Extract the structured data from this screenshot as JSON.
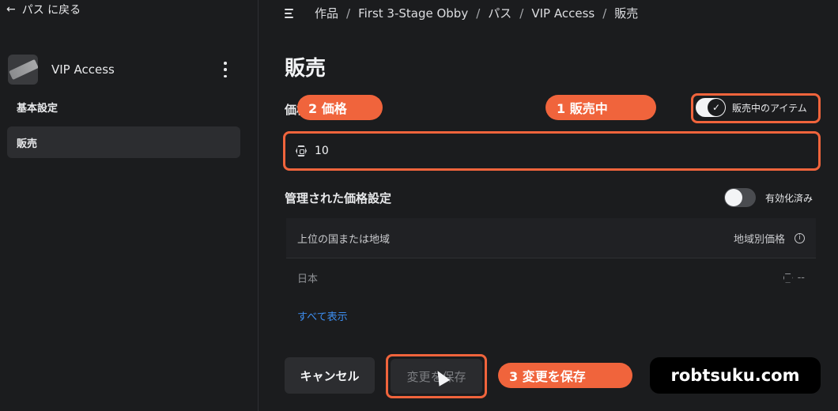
{
  "sidebar": {
    "back_label": "パス に戻る",
    "pass_name": "VIP Access",
    "items": [
      {
        "label": "基本設定"
      },
      {
        "label": "販売"
      }
    ]
  },
  "breadcrumb": [
    "作品",
    "First 3-Stage Obby",
    "パス",
    "VIP Access",
    "販売"
  ],
  "page_title": "販売",
  "price": {
    "label": "価格",
    "value": "10"
  },
  "sale_toggle": {
    "label": "販売中のアイテム",
    "state": "on"
  },
  "managed_pricing": {
    "title": "管理された価格設定",
    "status": "有効化済み",
    "state": "off"
  },
  "region_table": {
    "header_left": "上位の国または地域",
    "header_right": "地域別価格",
    "rows": [
      {
        "region": "日本",
        "price": "--"
      }
    ],
    "show_all": "すべて表示"
  },
  "buttons": {
    "cancel": "キャンセル",
    "save": "変更を保存"
  },
  "annotations": {
    "a1": "1 販売中",
    "a2": "2 価格",
    "a3": "3 変更を保存"
  },
  "watermark": "robtsuku.com",
  "colors": {
    "annotation": "#f0643c",
    "link": "#3d8ef0",
    "background": "#1b1c1e"
  }
}
